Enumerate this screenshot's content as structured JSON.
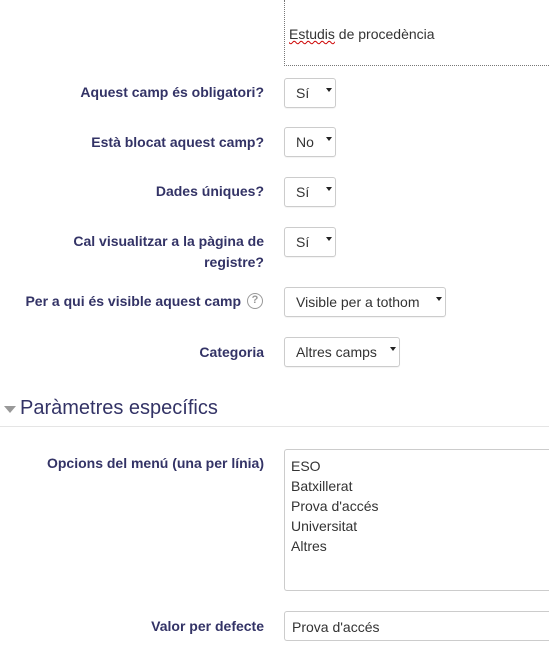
{
  "editor": {
    "first_word": "Estudis",
    "rest": " de procedència"
  },
  "fields": {
    "required": {
      "label": "Aquest camp és obligatori?",
      "value": "Sí"
    },
    "locked": {
      "label": "Està blocat aquest camp?",
      "value": "No"
    },
    "unique": {
      "label": "Dades úniques?",
      "value": "Sí"
    },
    "signup": {
      "label_line1": "Cal visualitzar a la pàgina de",
      "label_line2": "registre?",
      "value": "Sí"
    },
    "visible": {
      "label": "Per a qui és visible aquest camp",
      "value": "Visible per a tothom",
      "help_glyph": "?"
    },
    "category": {
      "label": "Categoria",
      "value": "Altres camps"
    }
  },
  "section": {
    "title": "Paràmetres específics"
  },
  "menu_options": {
    "label": "Opcions del menú (una per línia)",
    "items": [
      "ESO",
      "Batxillerat",
      "Prova d'accés",
      "Universitat",
      "Altres"
    ]
  },
  "default_value": {
    "label": "Valor per defecte",
    "value": "Prova d'accés"
  }
}
